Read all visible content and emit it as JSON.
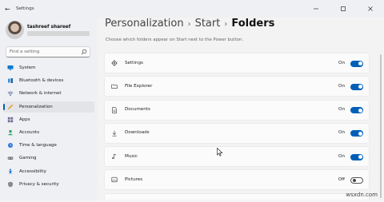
{
  "window": {
    "title": "Settings",
    "controls": [
      "minimize",
      "maximize",
      "close"
    ]
  },
  "user": {
    "name": "tashreef shareef"
  },
  "search": {
    "placeholder": "Find a setting"
  },
  "sidebar": {
    "items": [
      {
        "label": "System",
        "icon": "monitor-icon",
        "selected": false
      },
      {
        "label": "Bluetooth & devices",
        "icon": "bluetooth-icon",
        "selected": false
      },
      {
        "label": "Network & internet",
        "icon": "network-icon",
        "selected": false
      },
      {
        "label": "Personalization",
        "icon": "pen-icon",
        "selected": true
      },
      {
        "label": "Apps",
        "icon": "apps-icon",
        "selected": false
      },
      {
        "label": "Accounts",
        "icon": "person-icon",
        "selected": false
      },
      {
        "label": "Time & language",
        "icon": "globe-clock-icon",
        "selected": false
      },
      {
        "label": "Gaming",
        "icon": "gamepad-icon",
        "selected": false
      },
      {
        "label": "Accessibility",
        "icon": "accessibility-icon",
        "selected": false
      },
      {
        "label": "Privacy & security",
        "icon": "shield-icon",
        "selected": false
      }
    ]
  },
  "breadcrumb": {
    "items": [
      "Personalization",
      "Start"
    ],
    "current": "Folders"
  },
  "subtitle": "Choose which folders appear on Start next to the Power button.",
  "folders": [
    {
      "label": "Settings",
      "icon": "gear-icon",
      "state": "On",
      "on": true
    },
    {
      "label": "File Explorer",
      "icon": "file-explorer-icon",
      "state": "On",
      "on": true
    },
    {
      "label": "Documents",
      "icon": "document-icon",
      "state": "On",
      "on": true
    },
    {
      "label": "Downloads",
      "icon": "download-icon",
      "state": "On",
      "on": true
    },
    {
      "label": "Music",
      "icon": "music-icon",
      "state": "On",
      "on": true
    },
    {
      "label": "Pictures",
      "icon": "picture-icon",
      "state": "Off",
      "on": false
    }
  ],
  "watermark": "wsxdn.com",
  "colors": {
    "accent": "#005fb8",
    "background": "#f3f3f3",
    "card": "#fbfbfb"
  }
}
